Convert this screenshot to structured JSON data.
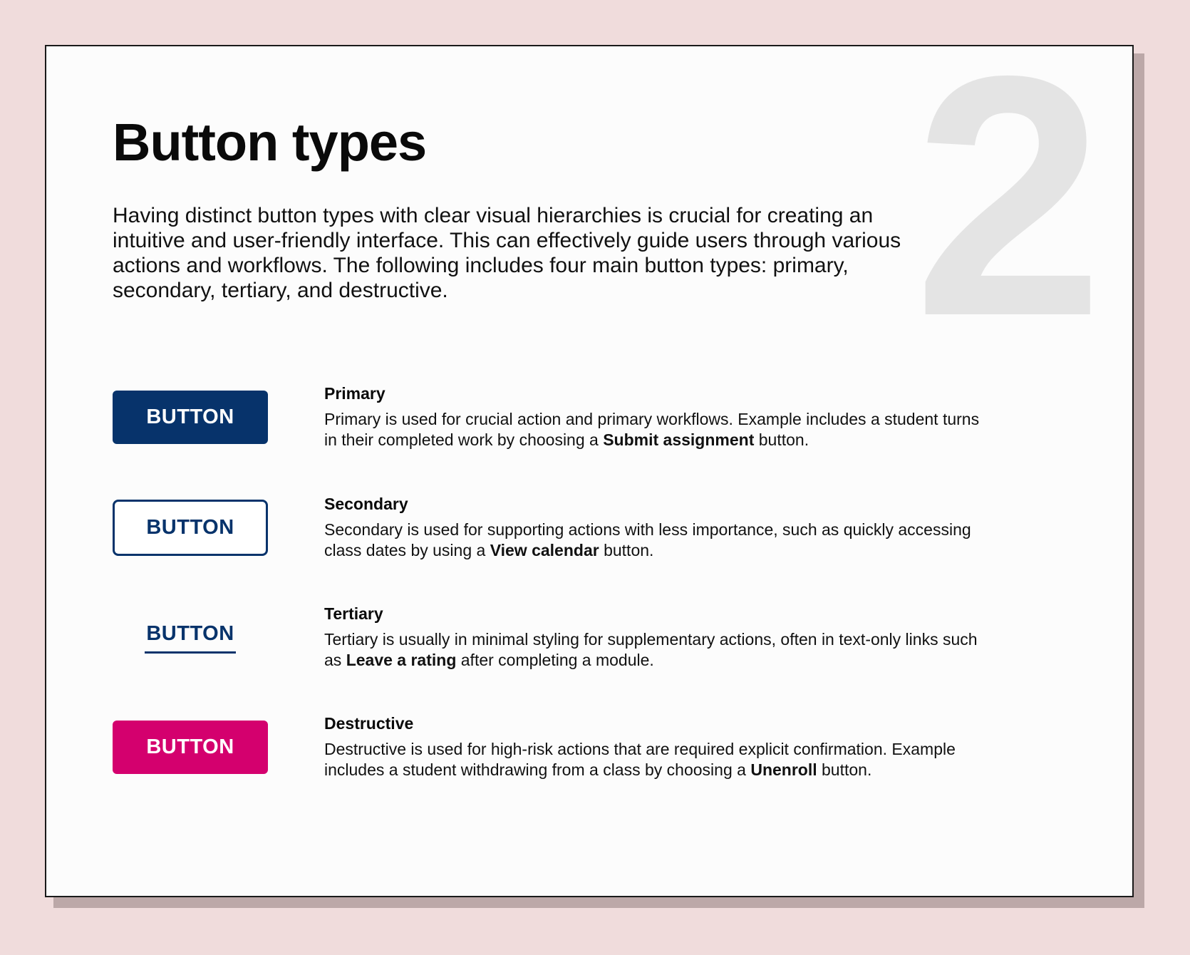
{
  "page": {
    "number": "2",
    "title": "Button types",
    "intro": "Having distinct button types with clear visual hierarchies is crucial for creating an intuitive and user-friendly interface. This can effectively guide users through various actions and workflows. The following includes four main button types: primary, secondary, tertiary, and destructive."
  },
  "colors": {
    "background": "#f0dcdc",
    "primary": "#07336b",
    "destructive": "#d4006e",
    "number_watermark": "#e4e4e4"
  },
  "button_types": [
    {
      "button_label": "BUTTON",
      "title": "Primary",
      "text_before": "Primary is used for crucial action and primary workflows. Example includes a student turns in their completed work by choosing a ",
      "emphasis": "Submit assignment",
      "text_after": " button."
    },
    {
      "button_label": "BUTTON",
      "title": "Secondary",
      "text_before": "Secondary is used for supporting actions with less importance, such as quickly accessing class dates by using a ",
      "emphasis": "View calendar",
      "text_after": " button."
    },
    {
      "button_label": "BUTTON",
      "title": "Tertiary",
      "text_before": "Tertiary is usually in minimal styling for supplementary actions, often in text-only links such as ",
      "emphasis": "Leave a rating",
      "text_after": " after completing a module."
    },
    {
      "button_label": "BUTTON",
      "title": "Destructive",
      "text_before": "Destructive is used for high-risk actions that are required explicit confirmation. Example includes a student withdrawing from a class by choosing a ",
      "emphasis": "Unenroll",
      "text_after": " button."
    }
  ]
}
